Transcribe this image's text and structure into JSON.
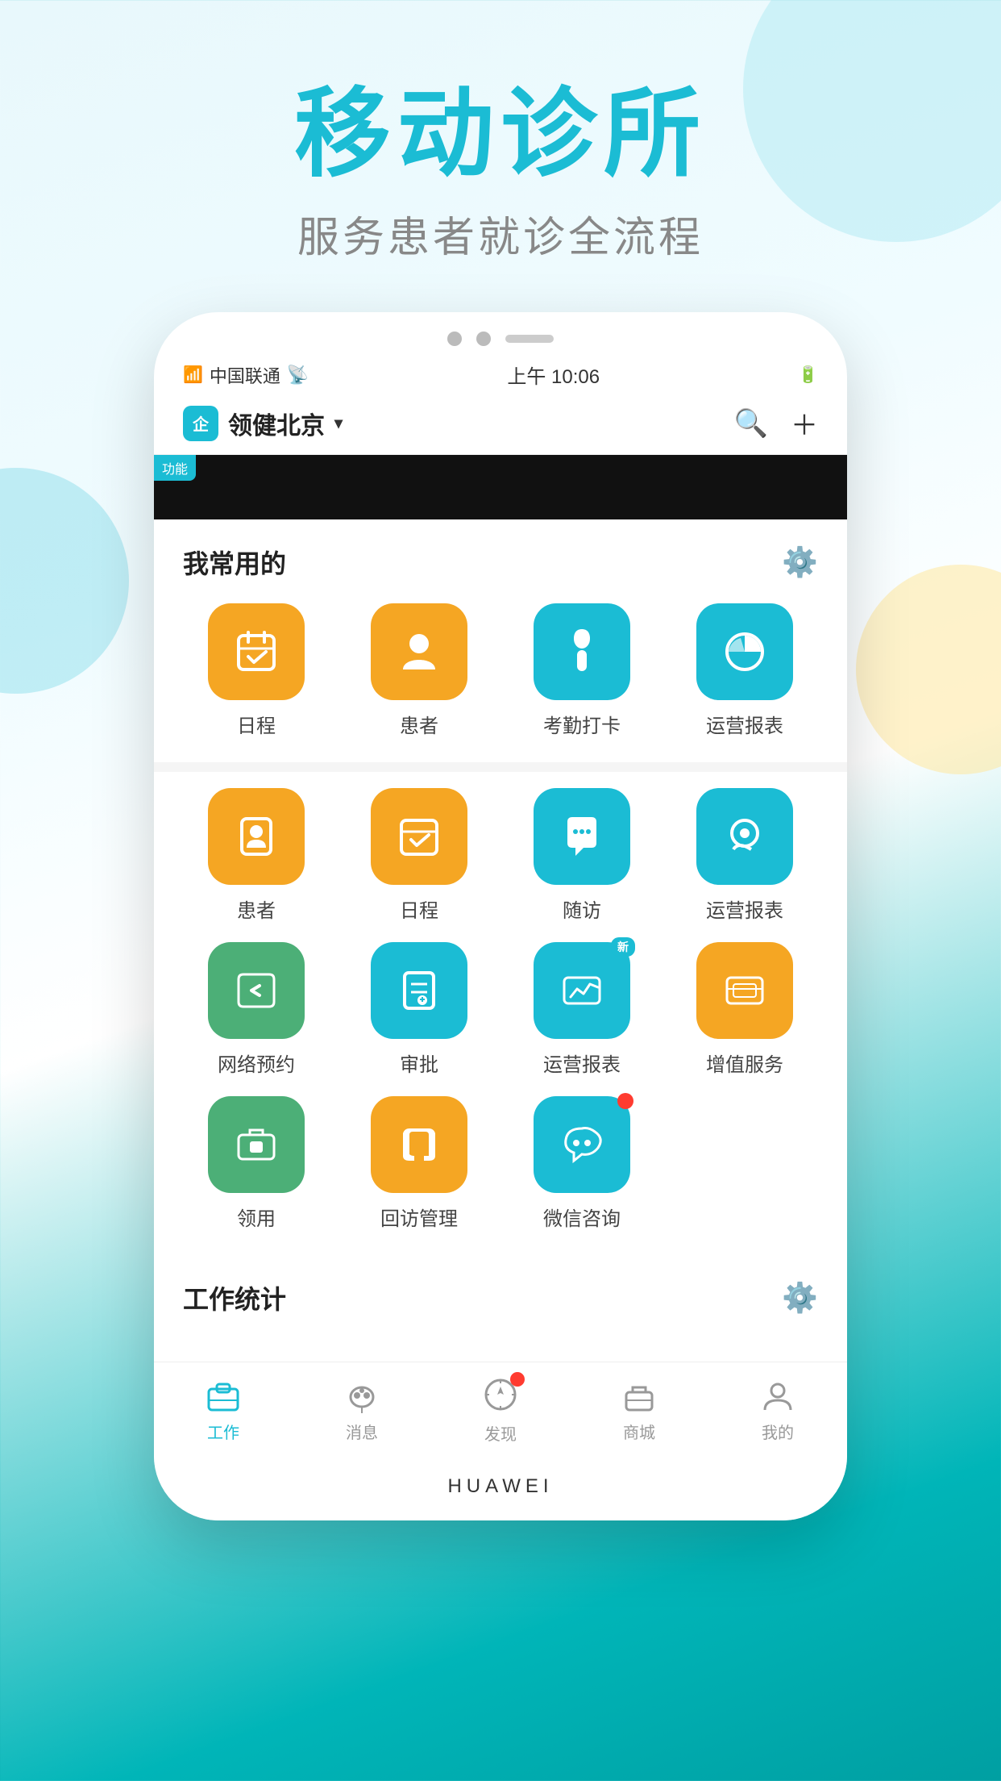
{
  "hero": {
    "title": "移动诊所",
    "subtitle": "服务患者就诊全流程"
  },
  "phone": {
    "status": {
      "carrier": "中国联通",
      "time": "上午 10:06"
    },
    "navbar": {
      "brand": "领健北京",
      "search_label": "🔍",
      "add_label": "+"
    },
    "promo_badge": "功能"
  },
  "section_common": {
    "title": "我常用的",
    "items": [
      {
        "label": "日程",
        "icon": "📅",
        "color": "color-yellow"
      },
      {
        "label": "患者",
        "icon": "👤",
        "color": "color-yellow"
      },
      {
        "label": "考勤打卡",
        "icon": "☝",
        "color": "color-teal"
      },
      {
        "label": "运营报表",
        "icon": "📊",
        "color": "color-teal"
      }
    ]
  },
  "section_all": {
    "items_row1": [
      {
        "label": "患者",
        "icon": "👔",
        "color": "color-yellow",
        "badge": ""
      },
      {
        "label": "日程",
        "icon": "✅",
        "color": "color-yellow",
        "badge": ""
      },
      {
        "label": "随访",
        "icon": "📞",
        "color": "color-teal",
        "badge": ""
      },
      {
        "label": "运营报表",
        "icon": "📞",
        "color": "color-teal",
        "badge": ""
      }
    ],
    "items_row2": [
      {
        "label": "网络预约",
        "icon": "‹",
        "color": "color-green",
        "badge": ""
      },
      {
        "label": "审批",
        "icon": "🖊",
        "color": "color-teal",
        "badge": ""
      },
      {
        "label": "运营报表",
        "icon": "📈",
        "color": "color-teal",
        "badge": "new"
      },
      {
        "label": "增值服务",
        "icon": "💻",
        "color": "color-yellow",
        "badge": ""
      }
    ],
    "items_row3": [
      {
        "label": "领用",
        "icon": "📢",
        "color": "color-green",
        "badge": ""
      },
      {
        "label": "回访管理",
        "icon": "📲",
        "color": "color-yellow",
        "badge": ""
      },
      {
        "label": "微信咨询",
        "icon": "🦷",
        "color": "color-teal",
        "badge": "dot"
      }
    ]
  },
  "section_stats": {
    "title": "工作统计"
  },
  "bottom_nav": {
    "items": [
      {
        "label": "工作",
        "active": true
      },
      {
        "label": "消息",
        "active": false
      },
      {
        "label": "发现",
        "active": false,
        "badge": true
      },
      {
        "label": "商城",
        "active": false
      },
      {
        "label": "我的",
        "active": false
      }
    ]
  },
  "huawei": {
    "brand": "HUAWEI"
  }
}
